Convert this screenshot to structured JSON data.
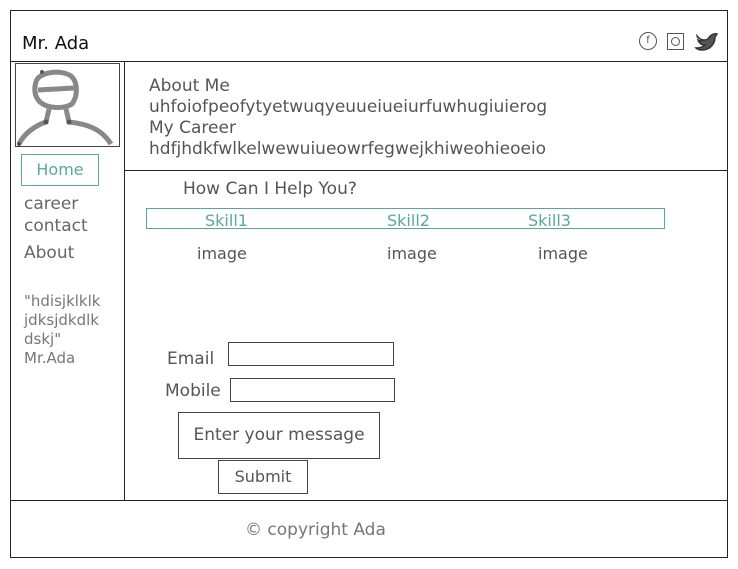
{
  "header": {
    "brand": "Mr. Ada",
    "icons": [
      "facebook-icon",
      "instagram-icon",
      "twitter-icon"
    ],
    "facebook_glyph": "f"
  },
  "sidebar": {
    "nav": [
      {
        "label": "Home",
        "active": true
      },
      {
        "label": "career"
      },
      {
        "label": "contact"
      },
      {
        "label": "About"
      }
    ],
    "quote_lines": [
      "\"hdisjklklk",
      "jdksjdkdlk",
      "dskj\"",
      "Mr.Ada"
    ]
  },
  "main": {
    "about_title": "About Me",
    "about_text": "uhfoiofpeofytyetwuqyeuueiueiurfuwhugiuierog",
    "career_title": "My Career",
    "career_text": "hdfjhdkfwlkelwewuiueowrfegwejkhiweohieoeio",
    "help_title": "How Can I Help You?",
    "skills": [
      {
        "label": "Skill1",
        "image": "image"
      },
      {
        "label": "Skill2",
        "image": "image"
      },
      {
        "label": "Skill3",
        "image": "image"
      }
    ]
  },
  "form": {
    "email_label": "Email",
    "email_value": "",
    "mobile_label": "Mobile",
    "mobile_value": "",
    "message_placeholder": "Enter your message",
    "submit_label": "Submit"
  },
  "footer": {
    "text": "© copyright Ada"
  },
  "colors": {
    "accent": "#5aa89a",
    "line": "#222222",
    "text": "#555555"
  }
}
